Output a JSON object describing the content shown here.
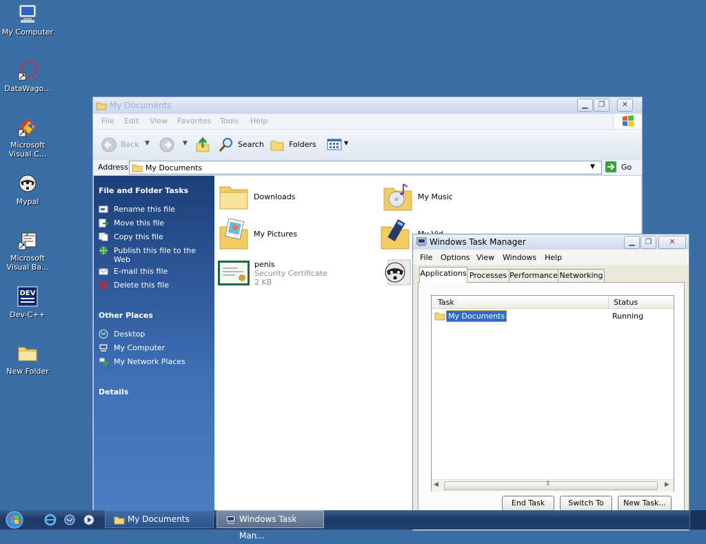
{
  "desktop": {
    "icons": [
      {
        "label": "My Computer"
      },
      {
        "label": "DataWago..."
      },
      {
        "label": "Microsoft Visual C..."
      },
      {
        "label": "Mypal"
      },
      {
        "label": "Microsoft Visual Ba..."
      },
      {
        "label": "Dev-C++"
      },
      {
        "label": "New Folder"
      }
    ]
  },
  "explorer": {
    "title": "My Documents",
    "menu": [
      "File",
      "Edit",
      "View",
      "Favorites",
      "Tools",
      "Help"
    ],
    "toolbar": {
      "back": "Back",
      "search": "Search",
      "folders": "Folders"
    },
    "address": {
      "label": "Address",
      "value": "My Documents",
      "go": "Go"
    },
    "side": {
      "file_tasks_title": "File and Folder Tasks",
      "file_tasks": [
        "Rename this file",
        "Move this file",
        "Copy this file",
        "Publish this file to the Web",
        "E-mail this file",
        "Delete this file"
      ],
      "other_places_title": "Other Places",
      "other_places": [
        "Desktop",
        "My Computer",
        "My Network Places"
      ],
      "details_title": "Details"
    },
    "files": [
      {
        "name": "Downloads"
      },
      {
        "name": "My Music"
      },
      {
        "name": "My Pictures"
      },
      {
        "name": "My Videos",
        "visible_text": "My Vid"
      },
      {
        "name": "penis",
        "type": "Security Certificate",
        "size": "2 KB"
      }
    ]
  },
  "taskmgr": {
    "title": "Windows Task Manager",
    "menu": [
      "File",
      "Options",
      "View",
      "Windows",
      "Help"
    ],
    "tabs": [
      "Applications",
      "Processes",
      "Performance",
      "Networking"
    ],
    "columns": {
      "task": "Task",
      "status": "Status"
    },
    "rows": [
      {
        "task": "My Documents",
        "status": "Running"
      }
    ],
    "buttons": {
      "end": "End Task",
      "switch": "Switch To",
      "new": "New Task..."
    }
  },
  "taskbar": {
    "items": [
      {
        "label": "My Documents"
      },
      {
        "label": "Windows Task Man..."
      }
    ]
  }
}
